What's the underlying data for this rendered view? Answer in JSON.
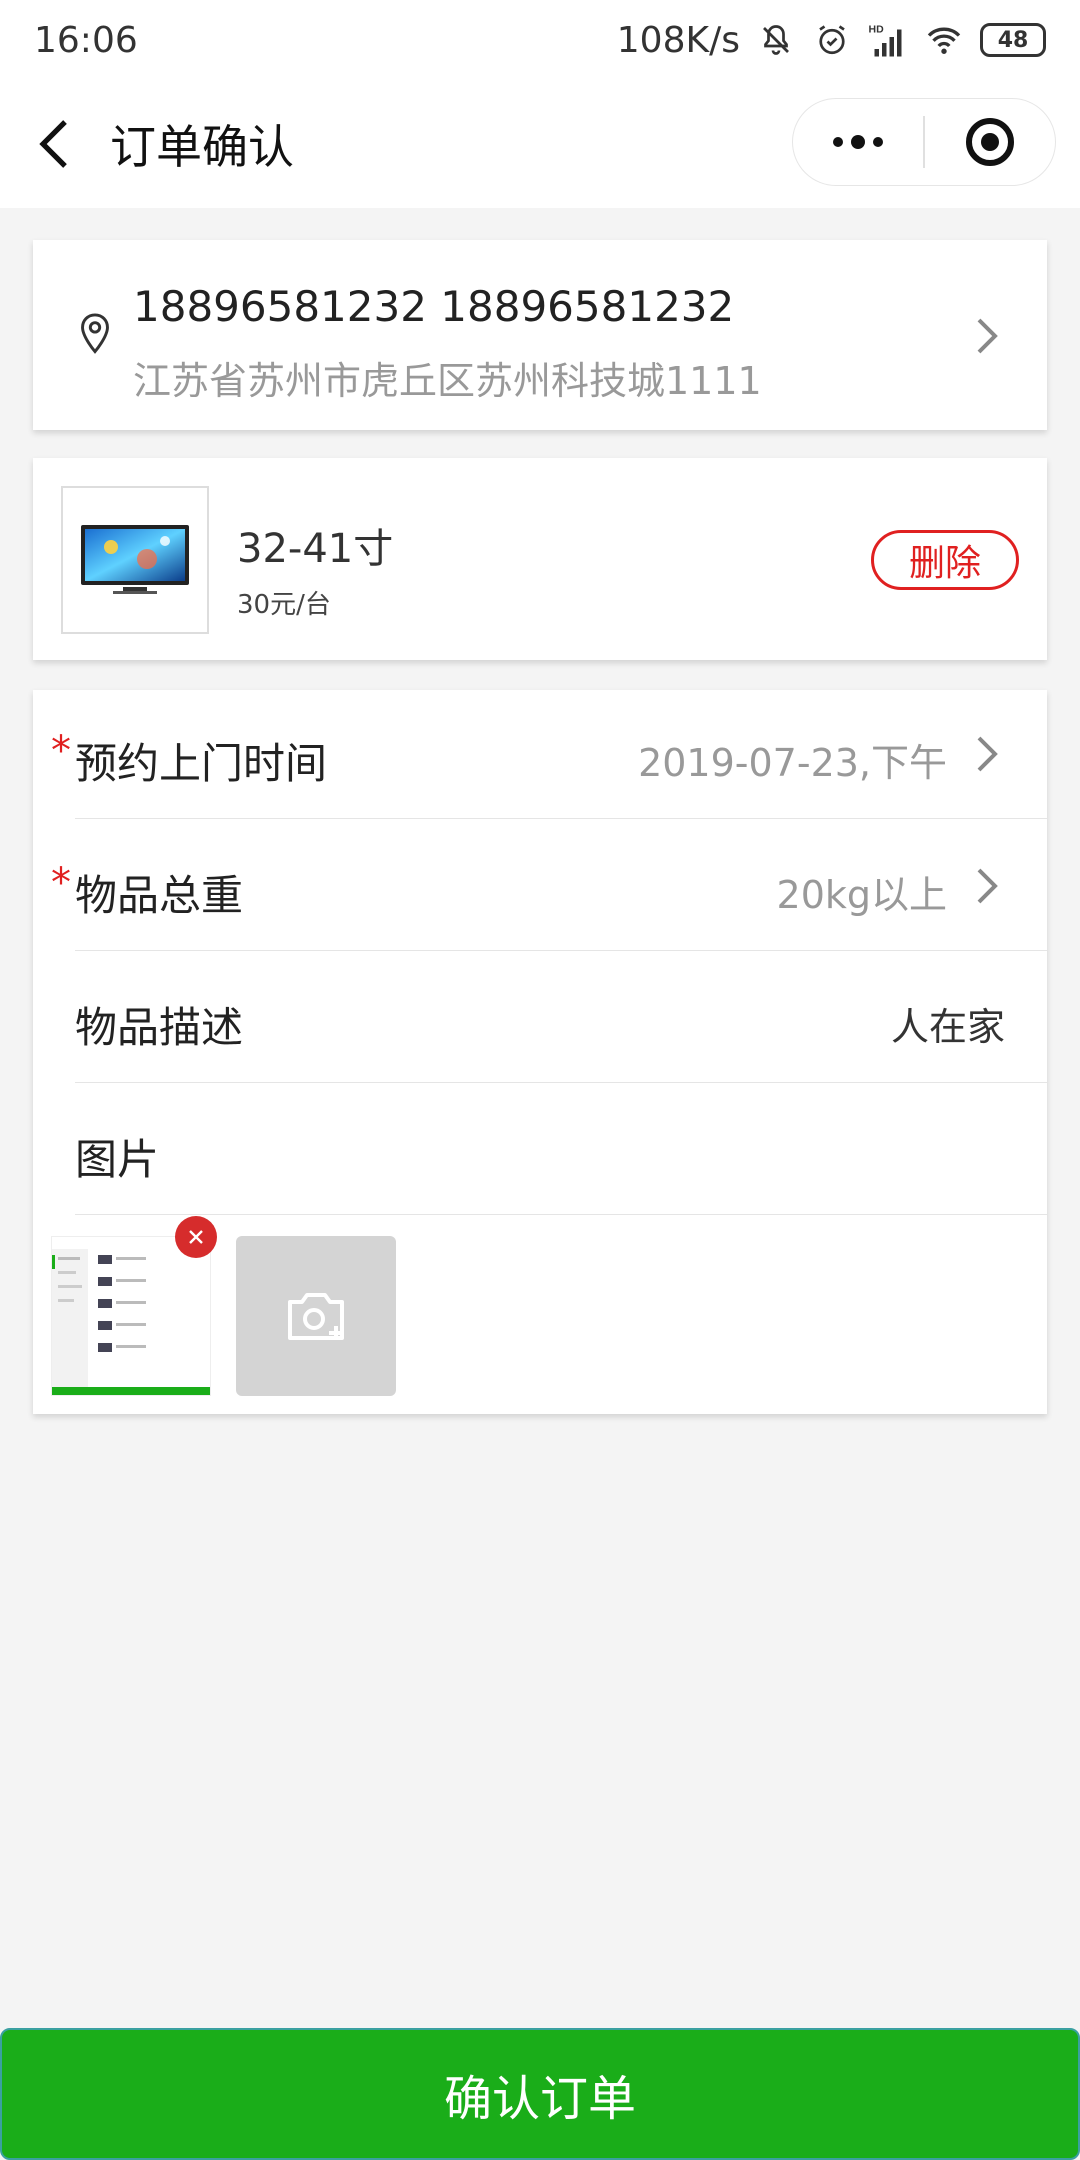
{
  "status_bar": {
    "time": "16:06",
    "network_speed": "108K/s",
    "battery": "48",
    "icons": [
      "mute-bell-icon",
      "alarm-icon",
      "hd-signal-icon",
      "wifi-icon",
      "battery-icon"
    ]
  },
  "nav": {
    "title": "订单确认",
    "back_icon": "chevron-left-icon",
    "menu_icon": "more-dots-icon",
    "close_icon": "target-circle-icon"
  },
  "address": {
    "name_phone": "18896581232 18896581232",
    "detail": "江苏省苏州市虎丘区苏州科技城1111",
    "icon": "location-pin-icon"
  },
  "product": {
    "name": "32-41寸",
    "price": "30元/台",
    "delete_label": "删除",
    "thumb_icon": "tv-image"
  },
  "form": {
    "required_mark": "*",
    "rows": [
      {
        "label": "预约上门时间",
        "value": "2019-07-23,下午",
        "required": true,
        "chevron": true
      },
      {
        "label": "物品总重",
        "value": "20kg以上",
        "required": true,
        "chevron": true
      },
      {
        "label": "物品描述",
        "value": "人在家",
        "required": false,
        "chevron": false
      },
      {
        "label": "图片",
        "value": "",
        "required": false,
        "chevron": false
      }
    ],
    "add_photo_icon": "camera-add-icon",
    "remove_photo_icon": "close-circle-icon"
  },
  "footer": {
    "confirm_label": "确认订单"
  },
  "colors": {
    "primary_green": "#1aad19",
    "danger_red": "#e02020",
    "page_bg": "#f4f4f4"
  }
}
